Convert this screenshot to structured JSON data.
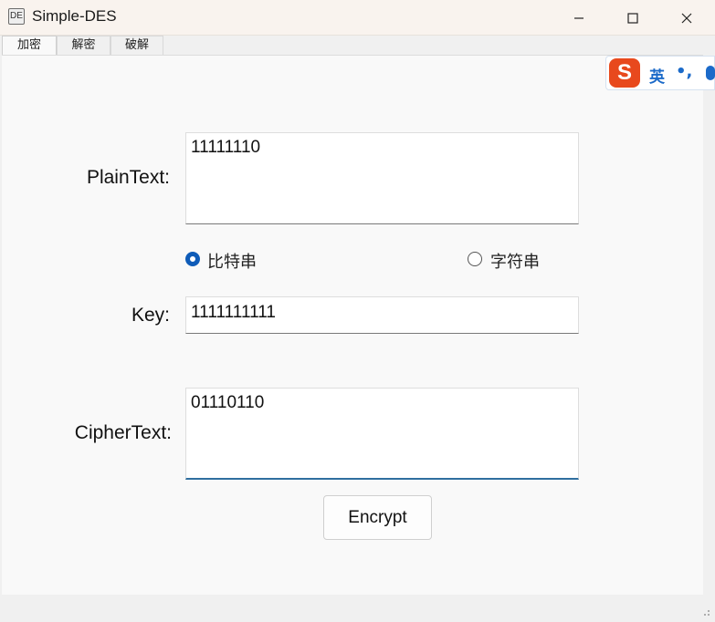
{
  "window": {
    "title": "Simple-DES",
    "app_icon_text": "DE",
    "controls": {
      "minimize": "–",
      "maximize": "☐",
      "close": "✕"
    }
  },
  "tabs": [
    {
      "label": "加密",
      "active": true
    },
    {
      "label": "解密",
      "active": false
    },
    {
      "label": "破解",
      "active": false
    }
  ],
  "form": {
    "plaintext_label": "PlainText:",
    "plaintext_value": "11111110",
    "mode_options": [
      {
        "label": "比特串",
        "selected": true
      },
      {
        "label": "字符串",
        "selected": false
      }
    ],
    "key_label": "Key:",
    "key_value": "1111111111",
    "ciphertext_label": "CipherText:",
    "ciphertext_value": "01110110",
    "encrypt_button": "Encrypt"
  },
  "ime": {
    "logo_letter": "S",
    "language": "英",
    "punctuation": "•,",
    "icon": "microphone-icon"
  }
}
